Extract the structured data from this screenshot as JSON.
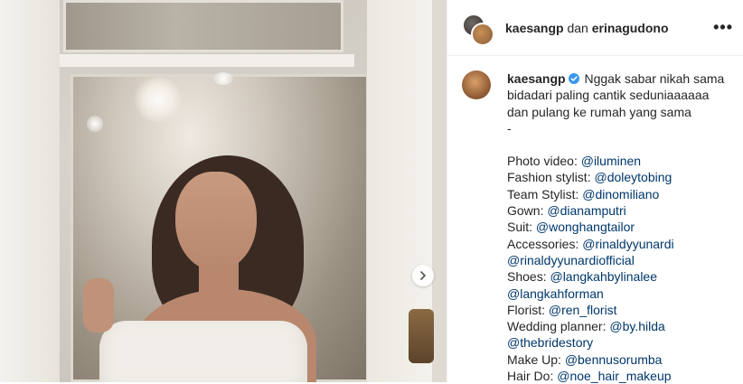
{
  "header": {
    "user1": "kaesangp",
    "conj": "dan",
    "user2": "erinagudono",
    "more_label": "•••"
  },
  "post": {
    "author": "kaesangp",
    "caption_lines": [
      "Nggak sabar nikah sama",
      "bidadari paling cantik seduniaaaaaa",
      "dan pulang ke rumah yang sama",
      "-"
    ],
    "credits": [
      {
        "label": "Photo video:",
        "handle": "@iluminen"
      },
      {
        "label": "Fashion stylist:",
        "handle": "@doleytobing"
      },
      {
        "label": "Team Stylist:",
        "handle": "@dinomiliano"
      },
      {
        "label": "Gown:",
        "handle": "@dianamputri"
      },
      {
        "label": "Suit:",
        "handle": "@wonghangtailor"
      },
      {
        "label": "Accessories:",
        "handle": "@rinaldyyunardi"
      },
      {
        "label": "",
        "handle": "@rinaldyyunardiofficial"
      },
      {
        "label": "Shoes:",
        "handle": "@langkahbylinalee"
      },
      {
        "label": "",
        "handle": "@langkahforman"
      },
      {
        "label": "Florist:",
        "handle": "@ren_florist"
      },
      {
        "label": "Wedding planner:",
        "handle": "@by.hilda"
      },
      {
        "label": "",
        "handle": "@thebridestory"
      },
      {
        "label": "Make Up:",
        "handle": "@bennusorumba"
      },
      {
        "label": "Hair Do:",
        "handle": "@noe_hair_makeup"
      }
    ]
  },
  "icons": {
    "next": "chevron-right-icon",
    "verified": "verified-badge-icon",
    "more": "more-options-icon"
  },
  "colors": {
    "text": "#262626",
    "verified": "#3897f0",
    "border": "#efefef"
  }
}
